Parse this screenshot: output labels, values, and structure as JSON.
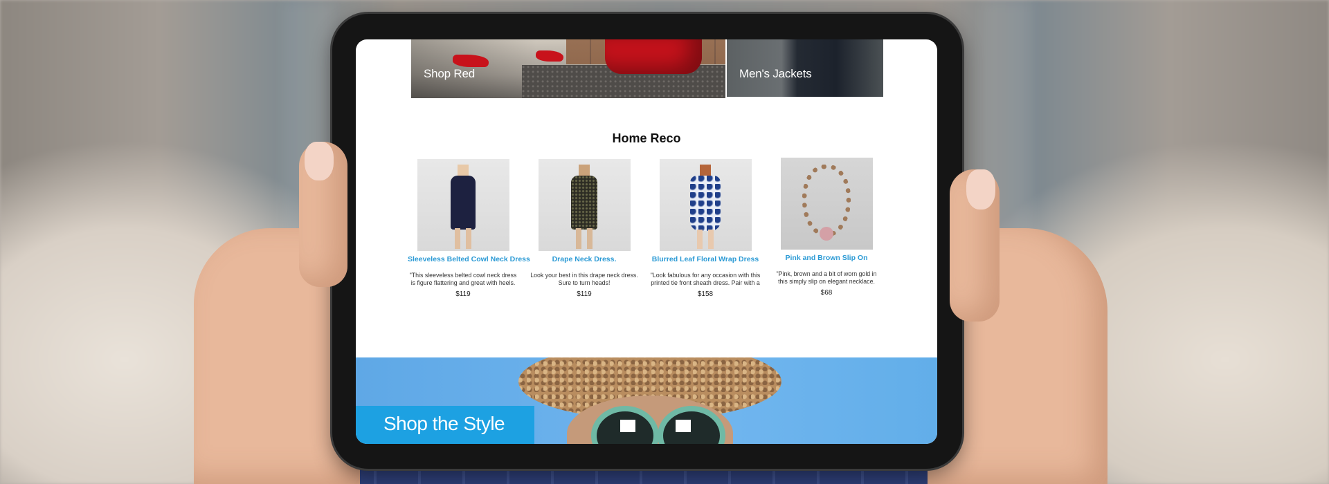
{
  "banners": [
    {
      "label": "Shop Red"
    },
    {
      "label": "Men's Jackets"
    }
  ],
  "section": {
    "title": "Home Reco"
  },
  "products": [
    {
      "name": "Sleeveless Belted Cowl Neck Dress",
      "description": "\"This sleeveless belted cowl neck dress is figure flattering and great with heels. Pair",
      "price": "$119"
    },
    {
      "name": "Drape Neck Dress.",
      "description": "Look your best in this drape neck dress. Sure to turn heads!",
      "price": "$119"
    },
    {
      "name": "Blurred Leaf Floral Wrap Dress",
      "description": "\"Look fabulous for any occasion with this printed tie front sheath dress. Pair with a",
      "price": "$158"
    },
    {
      "name": "Pink and Brown Slip On",
      "description": "\"Pink, brown and a bit of worn gold in this simply slip on elegant necklace. Each",
      "price": "$68"
    }
  ],
  "promo": {
    "label": "Shop the Style"
  },
  "colors": {
    "link_blue": "#2b9ad5",
    "promo_box": "#1da1e2",
    "promo_bg": "#6fb3ec"
  }
}
